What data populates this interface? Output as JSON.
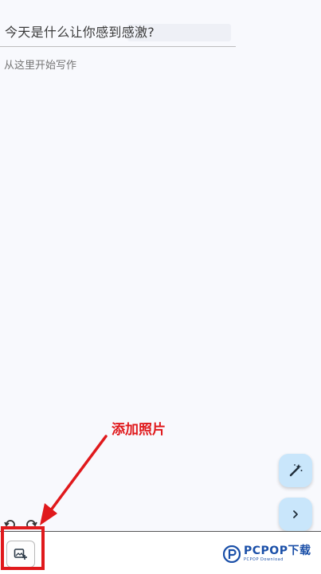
{
  "prompt": {
    "text": "今天是什么让你感到感激?"
  },
  "editor": {
    "placeholder": "从这里开始写作"
  },
  "annotation": {
    "text": "添加照片"
  },
  "watermark": {
    "brand": "PCPOP下载",
    "sub": "PCPOP Download"
  },
  "icons": {
    "magic": "magic-wand-icon",
    "next": "chevron-right-icon",
    "undo": "undo-icon",
    "redo": "redo-icon",
    "add_photo": "add-photo-icon"
  },
  "colors": {
    "accent_fab": "#c9e6fb",
    "annotation_red": "#e0191c",
    "background": "#f8f9fd"
  }
}
